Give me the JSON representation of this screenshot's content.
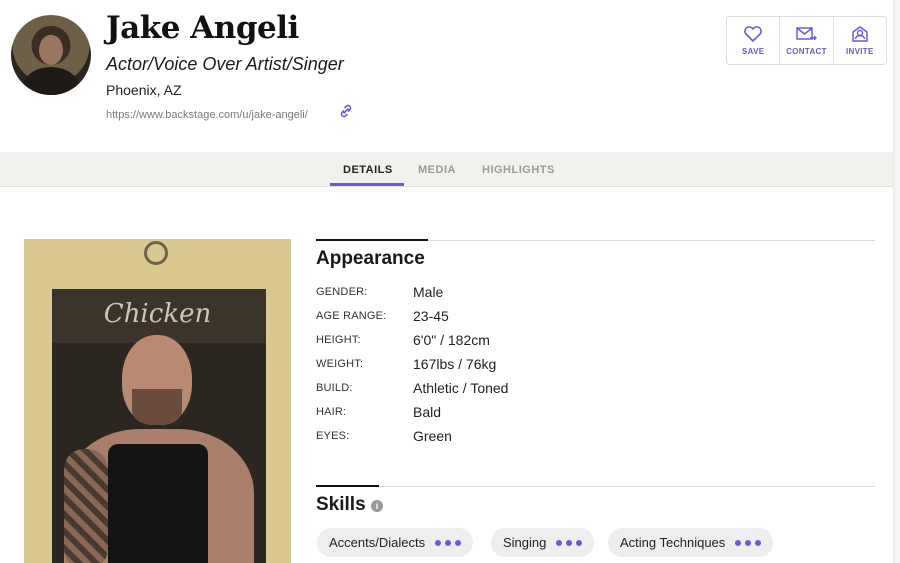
{
  "profile": {
    "name": "Jake Angeli",
    "role": "Actor/Voice Over Artist/Singer",
    "location": "Phoenix, AZ",
    "url": "https://www.backstage.com/u/jake-angeli/"
  },
  "actions": {
    "save": "SAVE",
    "contact": "CONTACT",
    "invite": "INVITE"
  },
  "tabs": [
    {
      "label": "DETAILS",
      "active": true
    },
    {
      "label": "MEDIA",
      "active": false
    },
    {
      "label": "HIGHLIGHTS",
      "active": false
    }
  ],
  "photo": {
    "poster_text": "Chicken"
  },
  "appearance": {
    "title": "Appearance",
    "rows": [
      {
        "label": "GENDER:",
        "value": "Male"
      },
      {
        "label": "AGE RANGE:",
        "value": "23-45"
      },
      {
        "label": "HEIGHT:",
        "value": "6'0\" / 182cm"
      },
      {
        "label": "WEIGHT:",
        "value": "167lbs / 76kg"
      },
      {
        "label": "BUILD:",
        "value": "Athletic / Toned"
      },
      {
        "label": "HAIR:",
        "value": "Bald"
      },
      {
        "label": "EYES:",
        "value": "Green"
      }
    ]
  },
  "skills": {
    "title": "Skills",
    "info_icon": "i",
    "chips": [
      "Accents/Dialects",
      "Singing",
      "Acting Techniques"
    ]
  },
  "colors": {
    "accent": "#6b5bd6",
    "action_text": "#7257c4",
    "tabbar_bg": "#f3f1ee"
  }
}
